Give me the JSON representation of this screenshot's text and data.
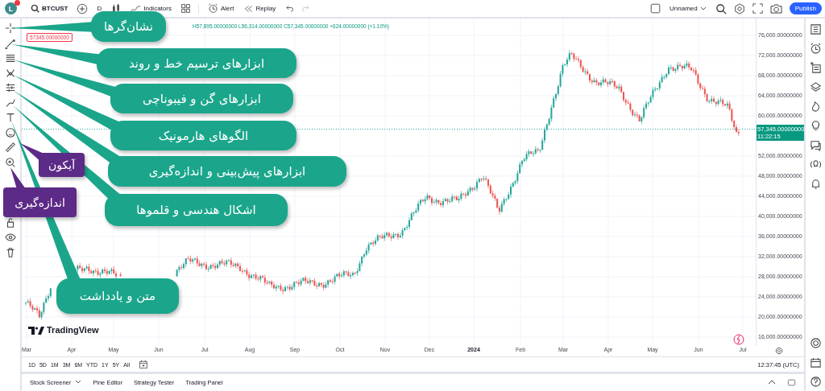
{
  "topbar": {
    "avatar": "L",
    "symbol": "BTCUST",
    "interval": "D",
    "indicators": "Indicators",
    "alert": "Alert",
    "replay": "Replay",
    "layout_name": "Unnamed",
    "publish": "Publish"
  },
  "legend": {
    "values": "H57,895.00000000 L56,314.00000000 C57,345.00000000 +624.00000000 (+1.10%)",
    "price_tag": "57345.00000000"
  },
  "price_axis": {
    "ticks": [
      "76,000.00000000",
      "72,000.00000000",
      "68,000.00000000",
      "64,000.00000000",
      "60,000.00000000",
      "52,000.00000000",
      "48,000.00000000",
      "44,000.00000000",
      "40,000.00000000",
      "36,000.00000000",
      "32,000.00000000",
      "28,000.00000000",
      "24,000.00000000",
      "20,000.00000000",
      "16,000.00000000"
    ],
    "last_price": "57,345.00000000",
    "countdown": "11:22:15"
  },
  "time_axis": {
    "labels": [
      {
        "text": "Mar",
        "bold": false
      },
      {
        "text": "Apr",
        "bold": false
      },
      {
        "text": "May",
        "bold": false
      },
      {
        "text": "Jun",
        "bold": false
      },
      {
        "text": "Jul",
        "bold": false
      },
      {
        "text": "Aug",
        "bold": false
      },
      {
        "text": "Sep",
        "bold": false
      },
      {
        "text": "Oct",
        "bold": false
      },
      {
        "text": "Nov",
        "bold": false
      },
      {
        "text": "Dec",
        "bold": false
      },
      {
        "text": "2024",
        "bold": true
      },
      {
        "text": "Feb",
        "bold": false
      },
      {
        "text": "Mar",
        "bold": false
      },
      {
        "text": "Apr",
        "bold": false
      },
      {
        "text": "May",
        "bold": false
      },
      {
        "text": "Jun",
        "bold": false
      },
      {
        "text": "Jul",
        "bold": false
      }
    ]
  },
  "brand": "TradingView",
  "range_bar": {
    "ranges": [
      "1D",
      "5D",
      "1M",
      "3M",
      "6M",
      "YTD",
      "1Y",
      "5Y",
      "All"
    ],
    "clock": "12:37:45 (UTC)"
  },
  "bottom_tabs": [
    "Stock Screener",
    "Pine Editor",
    "Strategy Tester",
    "Trading Panel"
  ],
  "callouts": [
    {
      "text": "نشان‌گرها",
      "color": "#1ba68b"
    },
    {
      "text": "ابزارهای ترسیم خط و روند",
      "color": "#1ba68b"
    },
    {
      "text": "ابزارهای گن و فیبوناچی",
      "color": "#1ba68b"
    },
    {
      "text": "الگوهای هارمونیک",
      "color": "#1ba68b"
    },
    {
      "text": "ابزارهای پیش‌بینی و اندازه‌گیری",
      "color": "#1ba68b"
    },
    {
      "text": "اشکال هندسی و قلموها",
      "color": "#1ba68b"
    },
    {
      "text": "متن و یادداشت",
      "color": "#1ba68b"
    },
    {
      "text": "آیکون",
      "color": "#5c2a87"
    },
    {
      "text": "اندازه‌گیری",
      "color": "#5c2a87"
    }
  ]
}
